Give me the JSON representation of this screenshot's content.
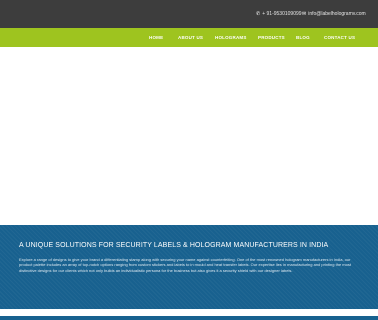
{
  "topbar": {
    "phone": "+ 91-9530109099",
    "email": "info@labelhologramv.com",
    "phone_icon": "phone-icon",
    "email_icon": "envelope-icon"
  },
  "nav": {
    "home": "HOME",
    "about": "ABOUT US",
    "holograms": "HOLOGRAMS",
    "products": "PRODUCTS",
    "blog": "BLOG",
    "contact": "CONTACT US"
  },
  "info": {
    "title": "A UNIQUE SOLUTIONS FOR SECURITY LABELS & HOLOGRAM MANUFACTURERS IN INDIA",
    "text": "Explore a range of designs to give your brand a differentiating stamp along with securing your name against counterfeiting. One of the most renowned hologram manufacturers in India, our product palette includes an array of top-notch options ranging from custom stickers and labels to in mould and heat transfer labels. Our expertise lies in manufacturing and printing the most distinctive designs for our clients which not only builds an individualistic persona for the business but also gives it a security shield with our designer labels."
  },
  "colors": {
    "topbar": "#3d3d3d",
    "nav": "#9ec41f",
    "info": "#18618f"
  }
}
